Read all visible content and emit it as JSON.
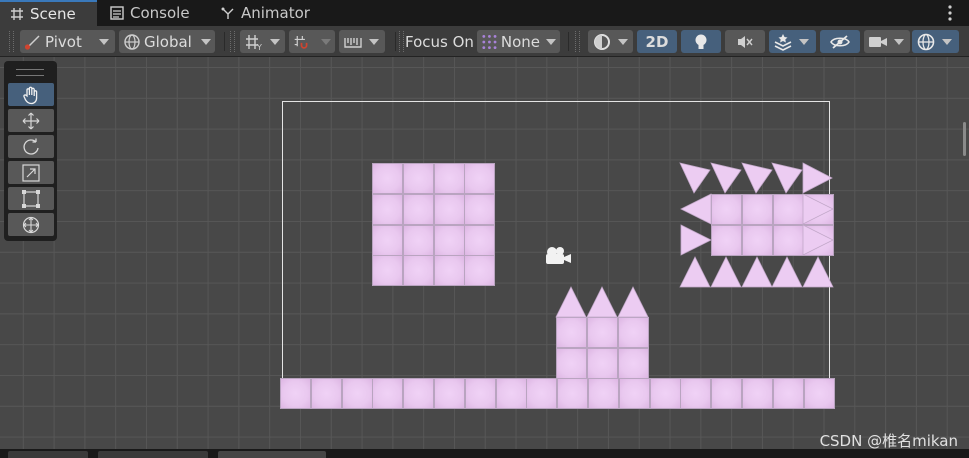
{
  "tabs": [
    {
      "label": "Scene",
      "icon": "grid-icon",
      "active": true
    },
    {
      "label": "Console",
      "icon": "console-icon",
      "active": false
    },
    {
      "label": "Animator",
      "icon": "animator-icon",
      "active": false
    }
  ],
  "toolbar": {
    "pivot_label": "Pivot",
    "global_label": "Global",
    "focus_on_label": "Focus On",
    "focus_target_label": "None",
    "mode_2d_label": "2D"
  },
  "tools": [
    "hand-tool",
    "move-tool",
    "rotate-tool",
    "scale-tool",
    "rect-tool",
    "transform-tool"
  ],
  "active_tool": "hand-tool",
  "watermark": "CSDN @椎名mikan",
  "colors": {
    "accent": "#46607c",
    "tile": "#ecccf2",
    "spike": "#e9c5ef",
    "viewport": "#484848"
  }
}
